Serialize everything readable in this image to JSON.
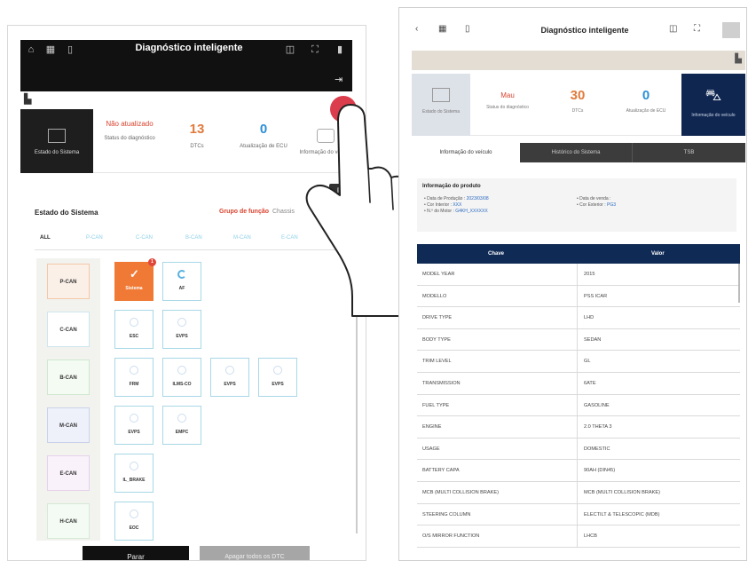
{
  "left": {
    "title": "Diagnóstico inteligente",
    "tabs": [
      {
        "value": "",
        "label": "Estado do Sistema"
      },
      {
        "value": "Não atualizado",
        "label": "Status do diagnóstico"
      },
      {
        "value": "13",
        "label": "DTCs"
      },
      {
        "value": "0",
        "label": "Atualização de ECU"
      },
      {
        "value": "",
        "label": "Informação do veículo"
      }
    ],
    "section_title": "Estado do Sistema",
    "group_label": "Grupo de função",
    "group_value": "Chassis",
    "filters": [
      "ALL",
      "P-CAN",
      "C-CAN",
      "B-CAN",
      "M-CAN",
      "E-CAN"
    ],
    "buses": [
      "P-CAN",
      "C-CAN",
      "B-CAN",
      "M-CAN",
      "E-CAN",
      "H-CAN"
    ],
    "modules": [
      {
        "bus": 0,
        "col": 0,
        "label": "Sistema",
        "highlight": true,
        "badge": "1"
      },
      {
        "bus": 0,
        "col": 1,
        "label": "AF",
        "spinner": true
      },
      {
        "bus": 1,
        "col": 0,
        "label": "ESC"
      },
      {
        "bus": 1,
        "col": 1,
        "label": "EVPS"
      },
      {
        "bus": 2,
        "col": 0,
        "label": "FRM"
      },
      {
        "bus": 2,
        "col": 1,
        "label": "ILMS-CO"
      },
      {
        "bus": 2,
        "col": 2,
        "label": "EVPS"
      },
      {
        "bus": 2,
        "col": 3,
        "label": "EVPS"
      },
      {
        "bus": 3,
        "col": 0,
        "label": "EVPS"
      },
      {
        "bus": 3,
        "col": 1,
        "label": "EMPC"
      },
      {
        "bus": 4,
        "col": 0,
        "label": "IL_BRAKE"
      },
      {
        "bus": 5,
        "col": 0,
        "label": "EOC"
      }
    ],
    "stop_label": "Parar",
    "clear_label": "Apagar todos os DTC"
  },
  "right": {
    "title": "Diagnóstico inteligente",
    "tabs": [
      {
        "value": "",
        "label": "Estado do Sistema"
      },
      {
        "value": "Mau",
        "label": "Status do diagnóstico"
      },
      {
        "value": "30",
        "label": "DTCs"
      },
      {
        "value": "0",
        "label": "Atualização de ECU"
      },
      {
        "value": "",
        "label": "Informação do veículo"
      }
    ],
    "subtabs": [
      "Informação do veículo",
      "Histórico do Sistema",
      "TSB"
    ],
    "info": {
      "heading": "Informação do produto",
      "lines_left": [
        {
          "label": "• Data de Produção :",
          "value": "2023/03/08"
        },
        {
          "label": "• Cor Interior :",
          "value": "XXX"
        },
        {
          "label": "• N.º do Motor :",
          "value": "G4KH_XXXXXX"
        }
      ],
      "lines_right": [
        {
          "label": "• Data de venda :",
          "value": ""
        },
        {
          "label": "• Cor Exterior :",
          "value": "PG3"
        }
      ]
    },
    "table": {
      "headers": [
        "Chave",
        "Valor"
      ],
      "rows": [
        [
          "MODEL YEAR",
          "2015"
        ],
        [
          "MODELLO",
          "PSS ICAR"
        ],
        [
          "DRIVE TYPE",
          "LHD"
        ],
        [
          "BODY TYPE",
          "SEDAN"
        ],
        [
          "TRIM LEVEL",
          "GL"
        ],
        [
          "TRANSMISSION",
          "6ATE"
        ],
        [
          "FUEL TYPE",
          "GASOLINE"
        ],
        [
          "ENGINE",
          "2.0 THETA 3"
        ],
        [
          "USAGE",
          "DOMESTIC"
        ],
        [
          "BATTERY CAPA",
          "90AH (DIN45)"
        ],
        [
          "MCB (MULTI COLLISION BRAKE)",
          "MCB (MULTI COLLISION BRAKE)"
        ],
        [
          "STEERING COLUMN",
          "ELECTILT & TELESCOPIC (MDB)"
        ],
        [
          "O/S MIRROR FUNCTION",
          "LHCB"
        ]
      ]
    }
  }
}
